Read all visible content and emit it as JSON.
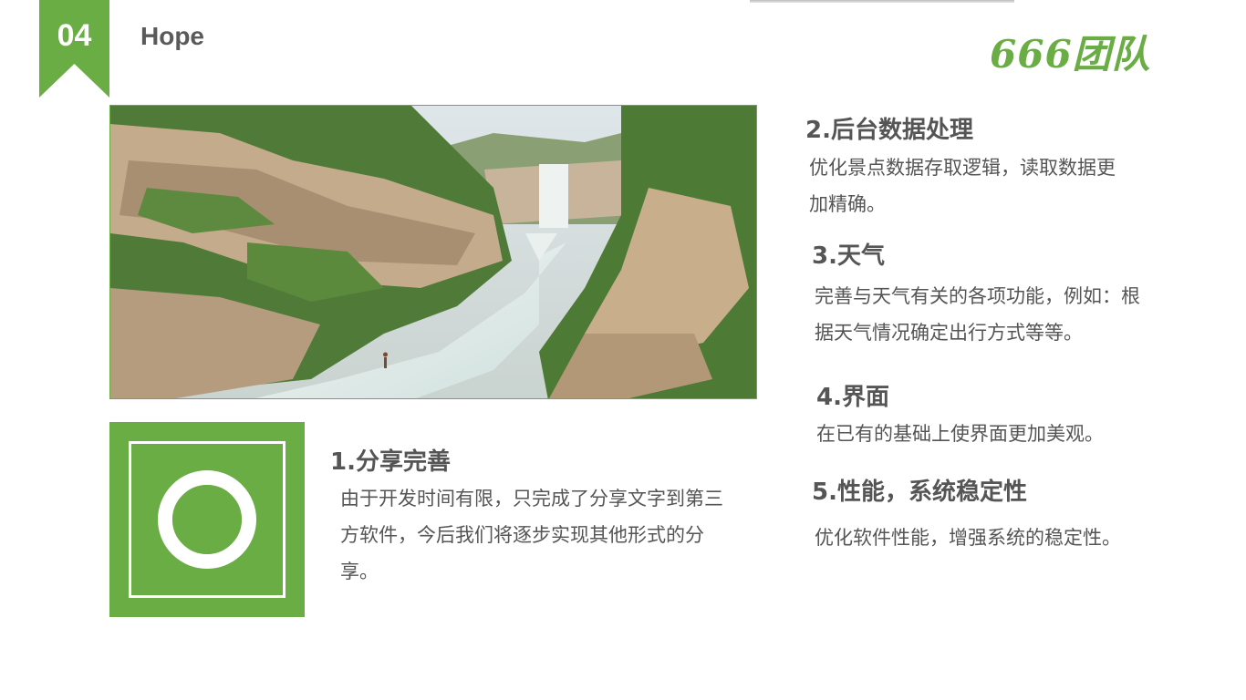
{
  "header": {
    "section_number": "04",
    "section_title": "Hope",
    "logo_text": "666团队"
  },
  "colors": {
    "accent": "#6aad44",
    "text": "#555555"
  },
  "photo": {
    "subject": "waterfall-landscape"
  },
  "icon_tile": {
    "icon": "lifebuoy-icon"
  },
  "items": [
    {
      "title": "1.分享完善",
      "body": "由于开发时间有限，只完成了分享文字到第三方软件，今后我们将逐步实现其他形式的分享。"
    },
    {
      "title": "2.后台数据处理",
      "body": "优化景点数据存取逻辑，读取数据更加精确。"
    },
    {
      "title": "3.天气",
      "body": "完善与天气有关的各项功能，例如：根据天气情况确定出行方式等等。"
    },
    {
      "title": "4.界面",
      "body": "在已有的基础上使界面更加美观。"
    },
    {
      "title": "5.性能，系统稳定性",
      "body": "优化软件性能，增强系统的稳定性。"
    }
  ]
}
